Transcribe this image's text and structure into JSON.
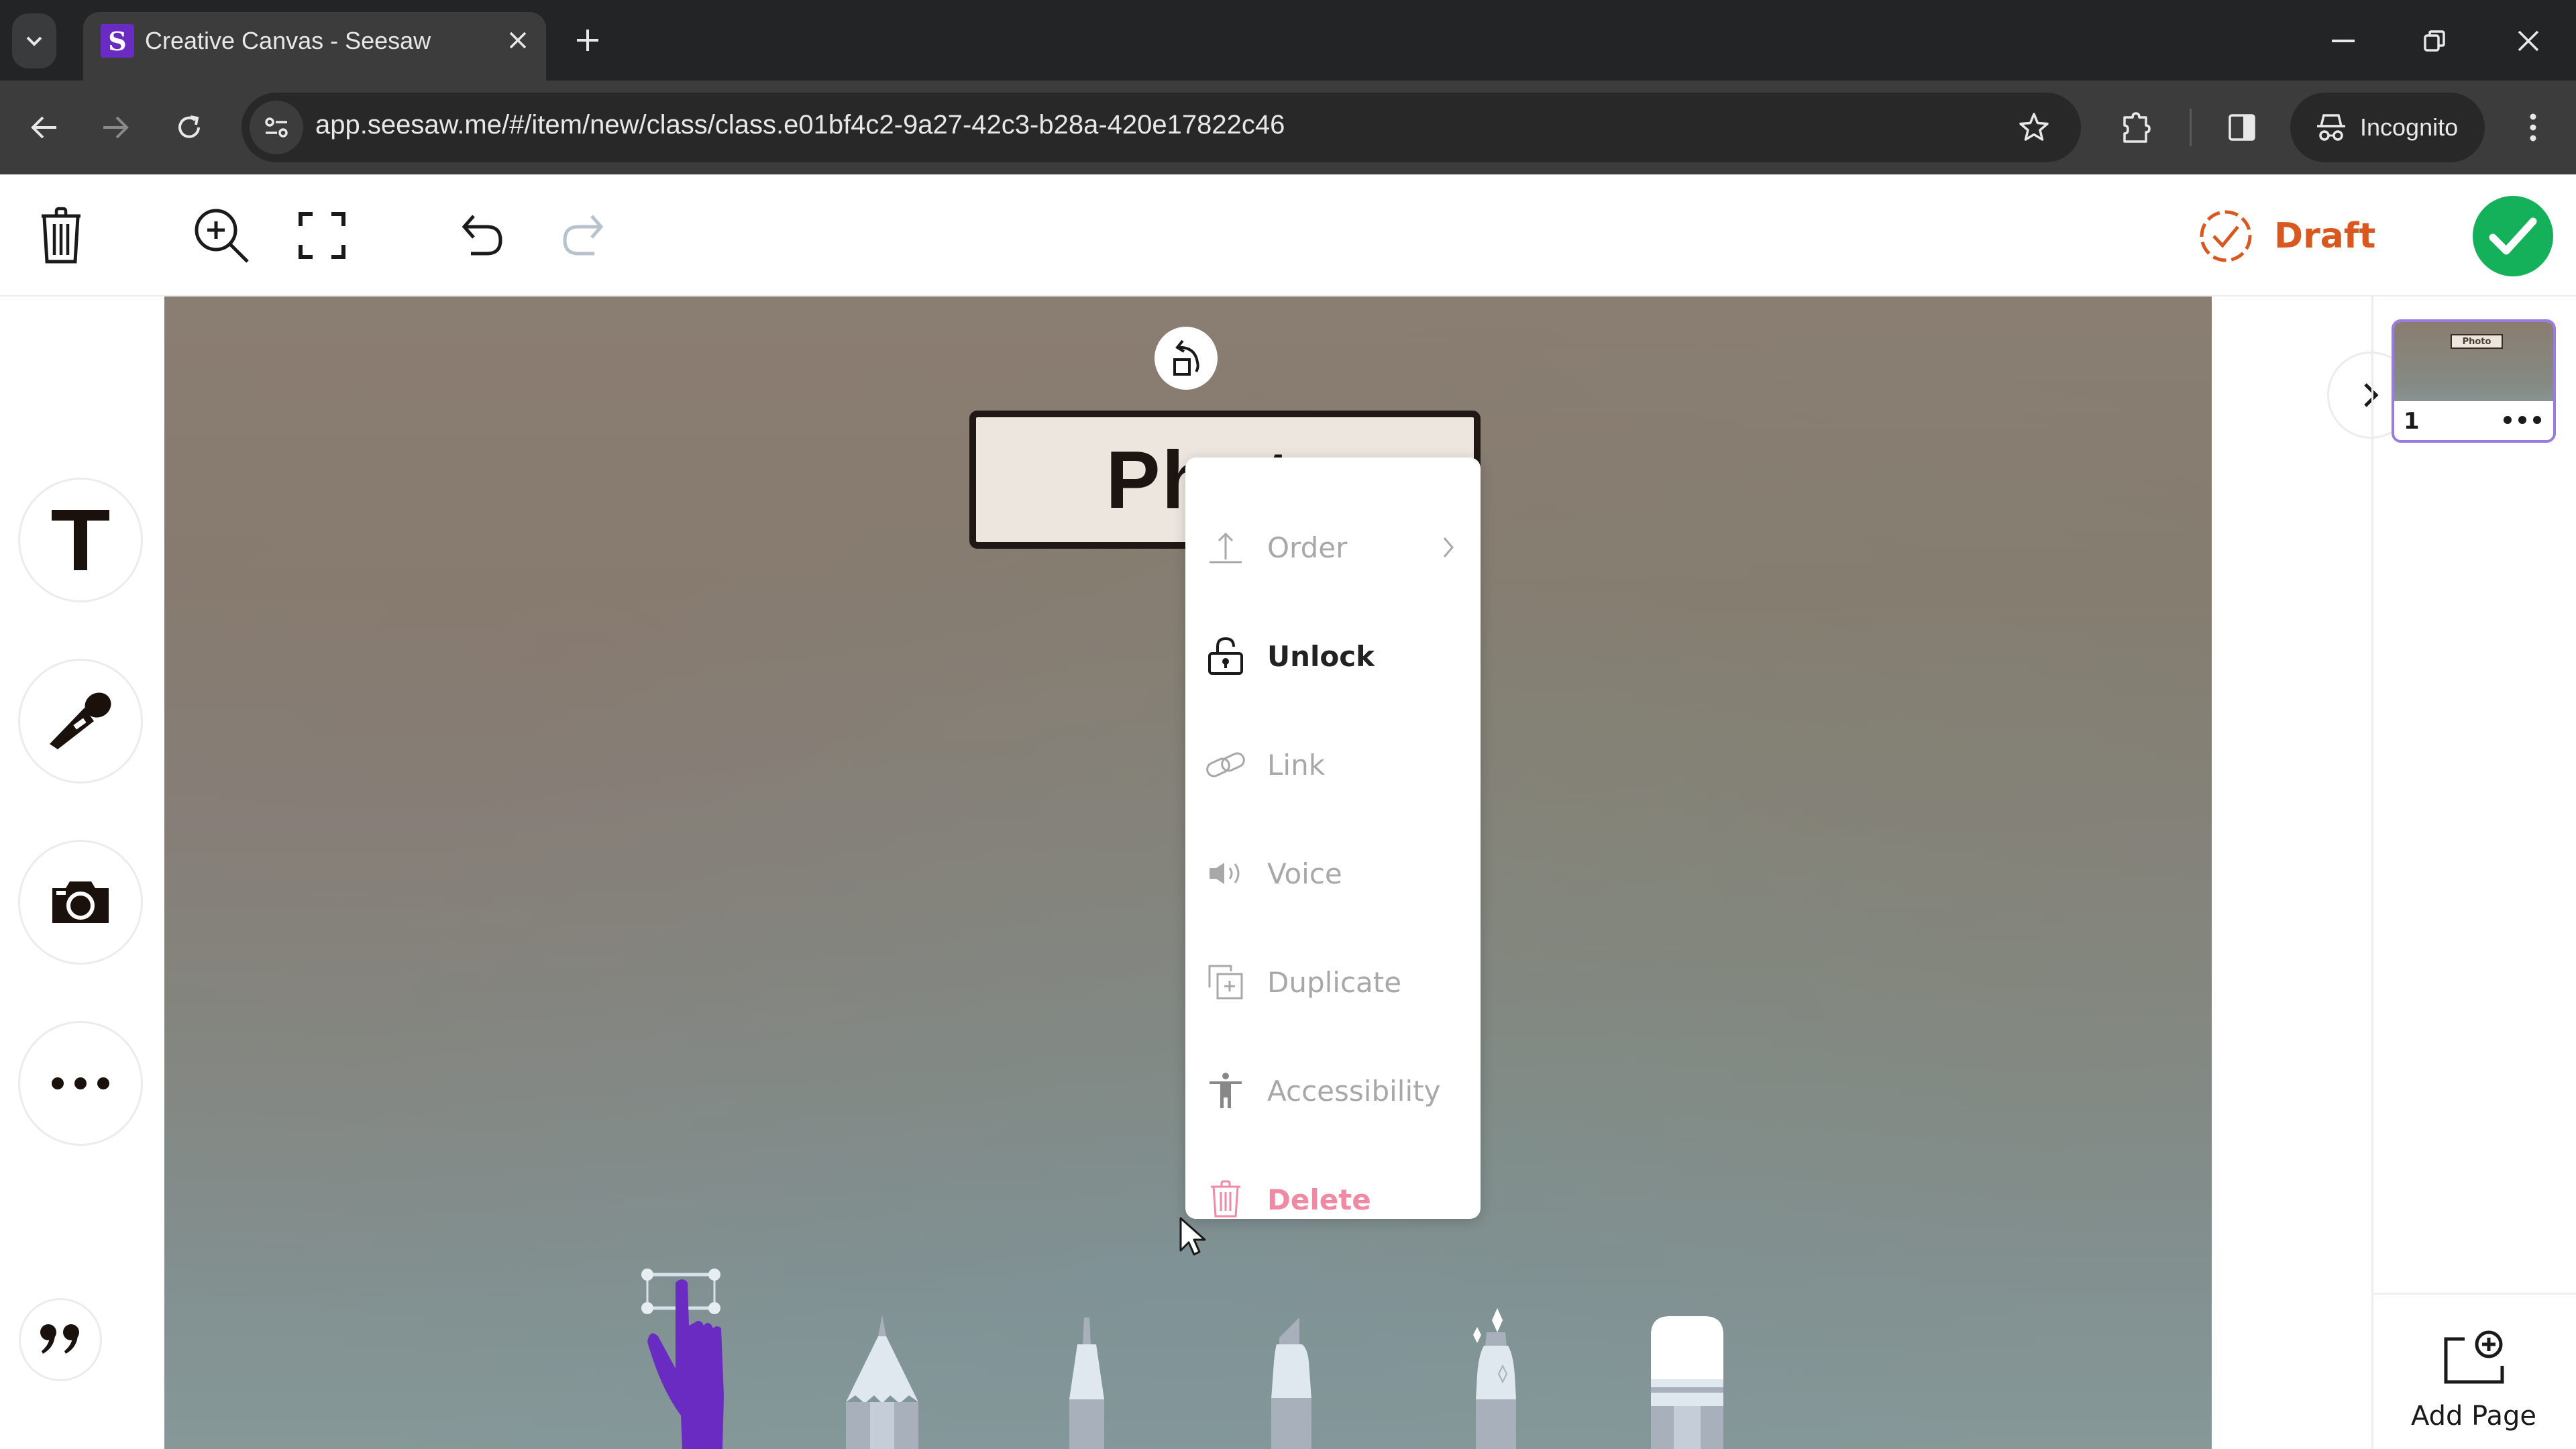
{
  "browser": {
    "tab": {
      "title": "Creative Canvas - Seesaw",
      "favicon": "seesaw-logo-icon",
      "favicon_letter": "S",
      "favicon_color": "#6a2bc3"
    },
    "new_tab_label": "+",
    "url": "app.seesaw.me/#/item/new/class/class.e01bf4c2-9a27-42c3-b28a-420e17822c46",
    "incognito_label": "Incognito",
    "icons": {
      "tab_search": "chevron-down-icon",
      "back": "back-arrow-icon",
      "forward": "forward-arrow-icon",
      "reload": "reload-icon",
      "site_info": "tune-icon",
      "bookmark": "star-icon",
      "extensions": "puzzle-icon",
      "side_panel": "side-panel-icon",
      "incognito": "incognito-icon",
      "menu": "kebab-menu-icon",
      "minimize": "minimize-icon",
      "restore": "restore-icon",
      "close": "close-icon"
    }
  },
  "app_toolbar": {
    "icons": [
      "trash-icon",
      "zoom-in-icon",
      "fullscreen-icon",
      "undo-icon",
      "redo-icon"
    ],
    "status": {
      "label": "Draft",
      "color": "#d8581f",
      "icon": "dashed-check-circle-icon"
    },
    "done": {
      "icon": "checkmark-icon",
      "color": "#14b05a"
    }
  },
  "left_tools": [
    {
      "name": "text",
      "icon": "text-icon",
      "glyph": "T"
    },
    {
      "name": "voice",
      "icon": "microphone-icon"
    },
    {
      "name": "camera",
      "icon": "camera-icon"
    },
    {
      "name": "more",
      "icon": "more-icon"
    },
    {
      "name": "quote",
      "icon": "quote-icon",
      "glyph": "”"
    }
  ],
  "canvas": {
    "label_text": "Photo",
    "visible_label_text": "Ph",
    "rotate_icon": "rotate-icon",
    "bottom_tools": [
      {
        "name": "select",
        "icon": "hand-select-icon",
        "active": true,
        "color": "#6a2bc3"
      },
      {
        "name": "pencil",
        "icon": "pencil-icon"
      },
      {
        "name": "pen",
        "icon": "pen-icon"
      },
      {
        "name": "marker",
        "icon": "marker-icon"
      },
      {
        "name": "glitter",
        "icon": "glitter-pen-icon"
      },
      {
        "name": "eraser",
        "icon": "eraser-icon"
      }
    ]
  },
  "context_menu": {
    "items": [
      {
        "label": "Order",
        "icon": "order-icon",
        "state": "disabled",
        "has_submenu": true
      },
      {
        "label": "Unlock",
        "icon": "unlock-icon",
        "state": "active"
      },
      {
        "label": "Link",
        "icon": "link-icon",
        "state": "disabled"
      },
      {
        "label": "Voice",
        "icon": "speaker-icon",
        "state": "disabled"
      },
      {
        "label": "Duplicate",
        "icon": "duplicate-icon",
        "state": "disabled"
      },
      {
        "label": "Accessibility",
        "icon": "accessibility-icon",
        "state": "disabled"
      },
      {
        "label": "Delete",
        "icon": "trash-icon",
        "state": "danger",
        "color": "#f08aa4"
      }
    ]
  },
  "pages_panel": {
    "expand_icon": "chevron-right-icon",
    "pages": [
      {
        "number": "1",
        "thumb_label": "Photo",
        "more_icon": "more-icon"
      }
    ],
    "add_page_label": "Add Page",
    "add_page_icon": "add-page-icon"
  }
}
